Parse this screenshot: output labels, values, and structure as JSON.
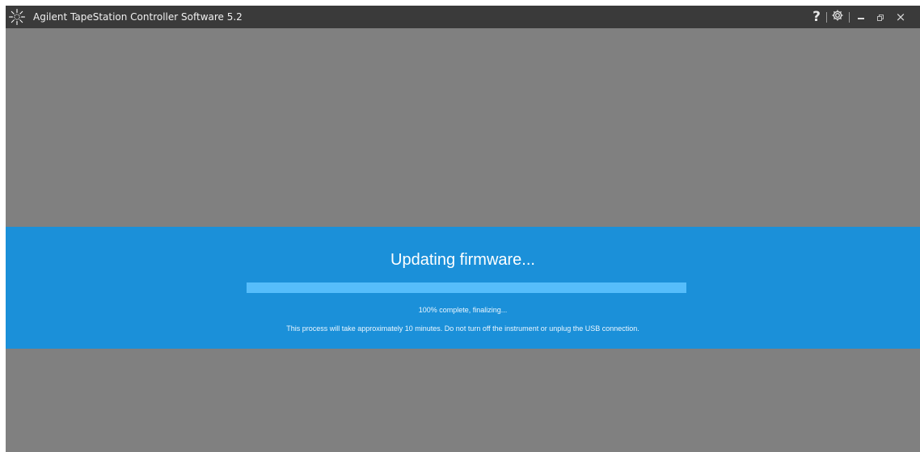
{
  "window": {
    "title": "Agilent TapeStation Controller Software 5.2",
    "controls": {
      "help": "?",
      "settings_icon": "gear-icon",
      "minimize_icon": "minimize-icon",
      "restore_icon": "restore-icon",
      "close": "×"
    }
  },
  "dialog": {
    "title": "Updating firmware...",
    "progress_fraction": 1.0,
    "status": "100% complete, finalizing...",
    "warning": "This process will take approximately 10 minutes.  Do not turn off the instrument or unplug the USB connection."
  },
  "colors": {
    "titlebar": "#3a3a3a",
    "background": "#808080",
    "banner": "#1b90d9",
    "progress_fill": "#56bdfb"
  }
}
